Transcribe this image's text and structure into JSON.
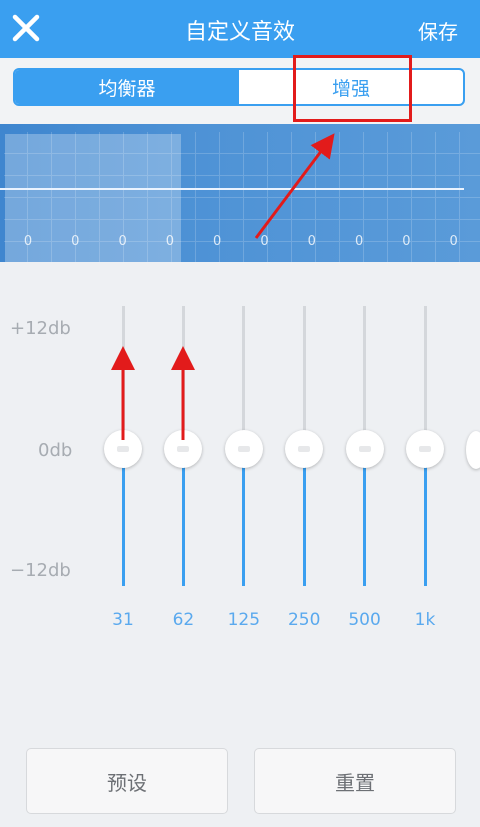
{
  "header": {
    "title": "自定义音效",
    "save_label": "保存",
    "background": "#3a9ff0",
    "close_icon": "close-icon"
  },
  "tabs": {
    "items": [
      {
        "label": "均衡器",
        "active": true
      },
      {
        "label": "增强",
        "active": false
      }
    ]
  },
  "curve": {
    "band_values": [
      "0",
      "0",
      "0",
      "0",
      "0",
      "0",
      "0",
      "0",
      "0",
      "0"
    ]
  },
  "scale": {
    "top": "+12db",
    "middle": "0db",
    "bottom": "−12db"
  },
  "sliders": [
    {
      "label": "31",
      "gain_db": 0
    },
    {
      "label": "62",
      "gain_db": 0
    },
    {
      "label": "125",
      "gain_db": 0
    },
    {
      "label": "250",
      "gain_db": 0
    },
    {
      "label": "500",
      "gain_db": 0
    },
    {
      "label": "1k",
      "gain_db": 0
    }
  ],
  "buttons": {
    "preset": "预设",
    "reset": "重置"
  },
  "colors": {
    "accent": "#3a9ff0",
    "annotation": "#e21b1b",
    "band_label": "#5aa9ee"
  }
}
